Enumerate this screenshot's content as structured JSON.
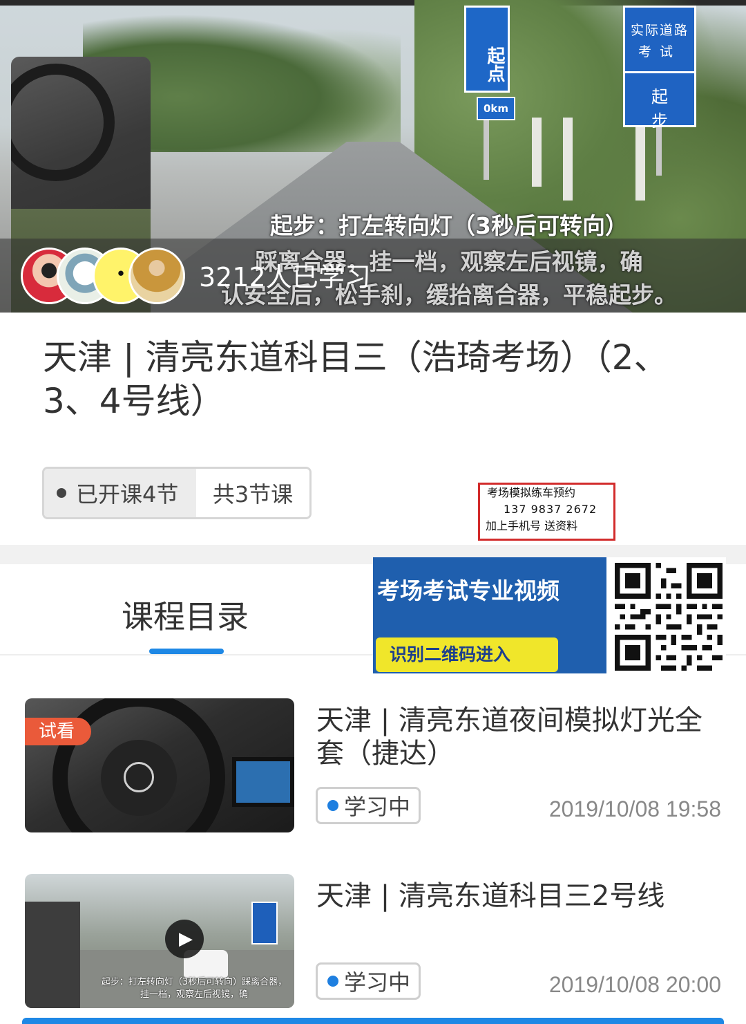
{
  "hero": {
    "caption_lines": [
      "起步：打左转向灯（3秒后可转向）",
      "踩离合器，挂一档，观察左后视镜，确",
      "认安全后，松手刹，缓抬离合器，平稳起步。"
    ],
    "sign_start": "起点",
    "sign_km": "0km",
    "sign_real": {
      "line1": "实际道路",
      "line2": "考试",
      "line3": "起步"
    },
    "learners_count_text": "3212人已学习"
  },
  "course": {
    "title": "天津 | 清亮东道科目三（浩琦考场）（2、3、4号线）",
    "opened_tag": "已开课4节",
    "total_tag": "共3节课"
  },
  "ad_box": {
    "line1": "考场模拟练车预约",
    "line2": "137  9837  2672",
    "line3": "加上手机号     送资料"
  },
  "promo": {
    "slogan": "考场考试专业视频",
    "cta": "识别二维码进入",
    "qr_icon": "qr-code-icon"
  },
  "section": {
    "title": "课程目录"
  },
  "lessons": [
    {
      "trial_badge": "试看",
      "title": "天津 | 清亮东道夜间模拟灯光全套（捷达）",
      "status": "学习中",
      "time": "2019/10/08 19:58"
    },
    {
      "title": "天津 | 清亮东道科目三2号线",
      "status": "学习中",
      "time": "2019/10/08 20:00",
      "thumb_caption": "起步：打左转向灯（3秒后可转向）踩离合器，挂一档，观察左后视镜，确"
    }
  ],
  "colors": {
    "accent_blue": "#1e88e5",
    "trial_orange": "#ea5a3a",
    "ad_border_red": "#d22b2b",
    "promo_blue": "#1f5fae",
    "promo_yellow": "#f0e62a"
  }
}
